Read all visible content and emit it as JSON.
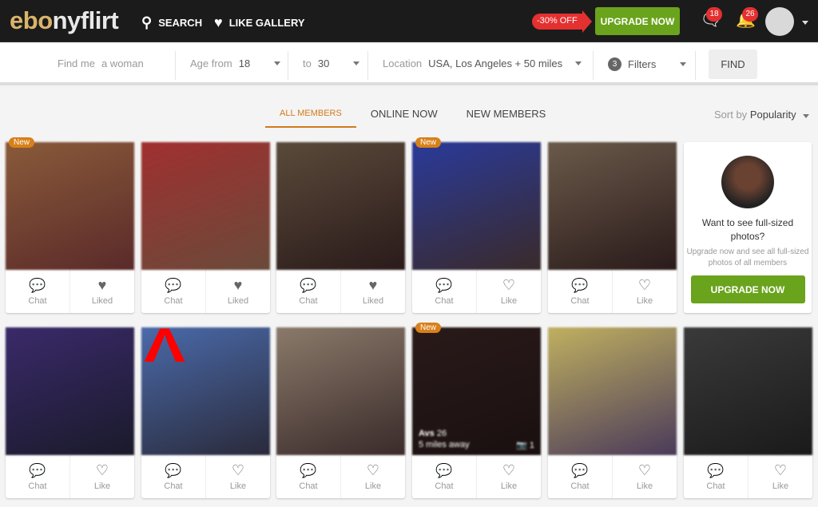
{
  "header": {
    "logo_a": "eb",
    "logo_b": "nyflirt",
    "logo_o": "o",
    "search": "SEARCH",
    "like_gallery": "LIKE GALLERY",
    "discount": "-30% OFF",
    "upgrade": "UPGRADE NOW",
    "messages_count": "18",
    "notifications_count": "26"
  },
  "filters": {
    "find_me_label": "Find me",
    "find_me_value": "a woman",
    "age_from_label": "Age from",
    "age_from": "18",
    "age_to_label": "to",
    "age_to": "30",
    "location_label": "Location",
    "location": "USA, Los Angeles + 50 miles",
    "filters_count": "3",
    "filters_label": "Filters",
    "find": "FIND"
  },
  "tabs": [
    "ALL MEMBERS",
    "ONLINE NOW",
    "NEW MEMBERS"
  ],
  "sort": {
    "label": "Sort by",
    "value": "Popularity"
  },
  "promo": {
    "heading": "Want to see full-sized photos?",
    "sub": "Upgrade now and see all full-sized photos of all members",
    "button": "UPGRADE NOW"
  },
  "chat_label": "Chat",
  "members": [
    {
      "new": "New",
      "like": "Liked",
      "liked": true
    },
    {
      "new": "",
      "like": "Liked",
      "liked": true
    },
    {
      "new": "",
      "like": "Liked",
      "liked": true
    },
    {
      "new": "New",
      "like": "Like",
      "liked": false
    },
    {
      "new": "",
      "like": "Like",
      "liked": false
    },
    {
      "new": "",
      "like": "Like",
      "liked": false
    },
    {
      "new": "",
      "like": "Like",
      "liked": false
    },
    {
      "new": "",
      "like": "Like",
      "liked": false
    },
    {
      "new": "New",
      "like": "Like",
      "liked": false,
      "name": "Avs",
      "age": "26",
      "distance": "5 miles away",
      "photos": "1"
    },
    {
      "new": "",
      "like": "Like",
      "liked": false
    },
    {
      "new": "",
      "like": "Like",
      "liked": false
    }
  ],
  "colors": {
    "accent": "#d27a1c",
    "green": "#6aa31c",
    "red": "#e53030"
  }
}
